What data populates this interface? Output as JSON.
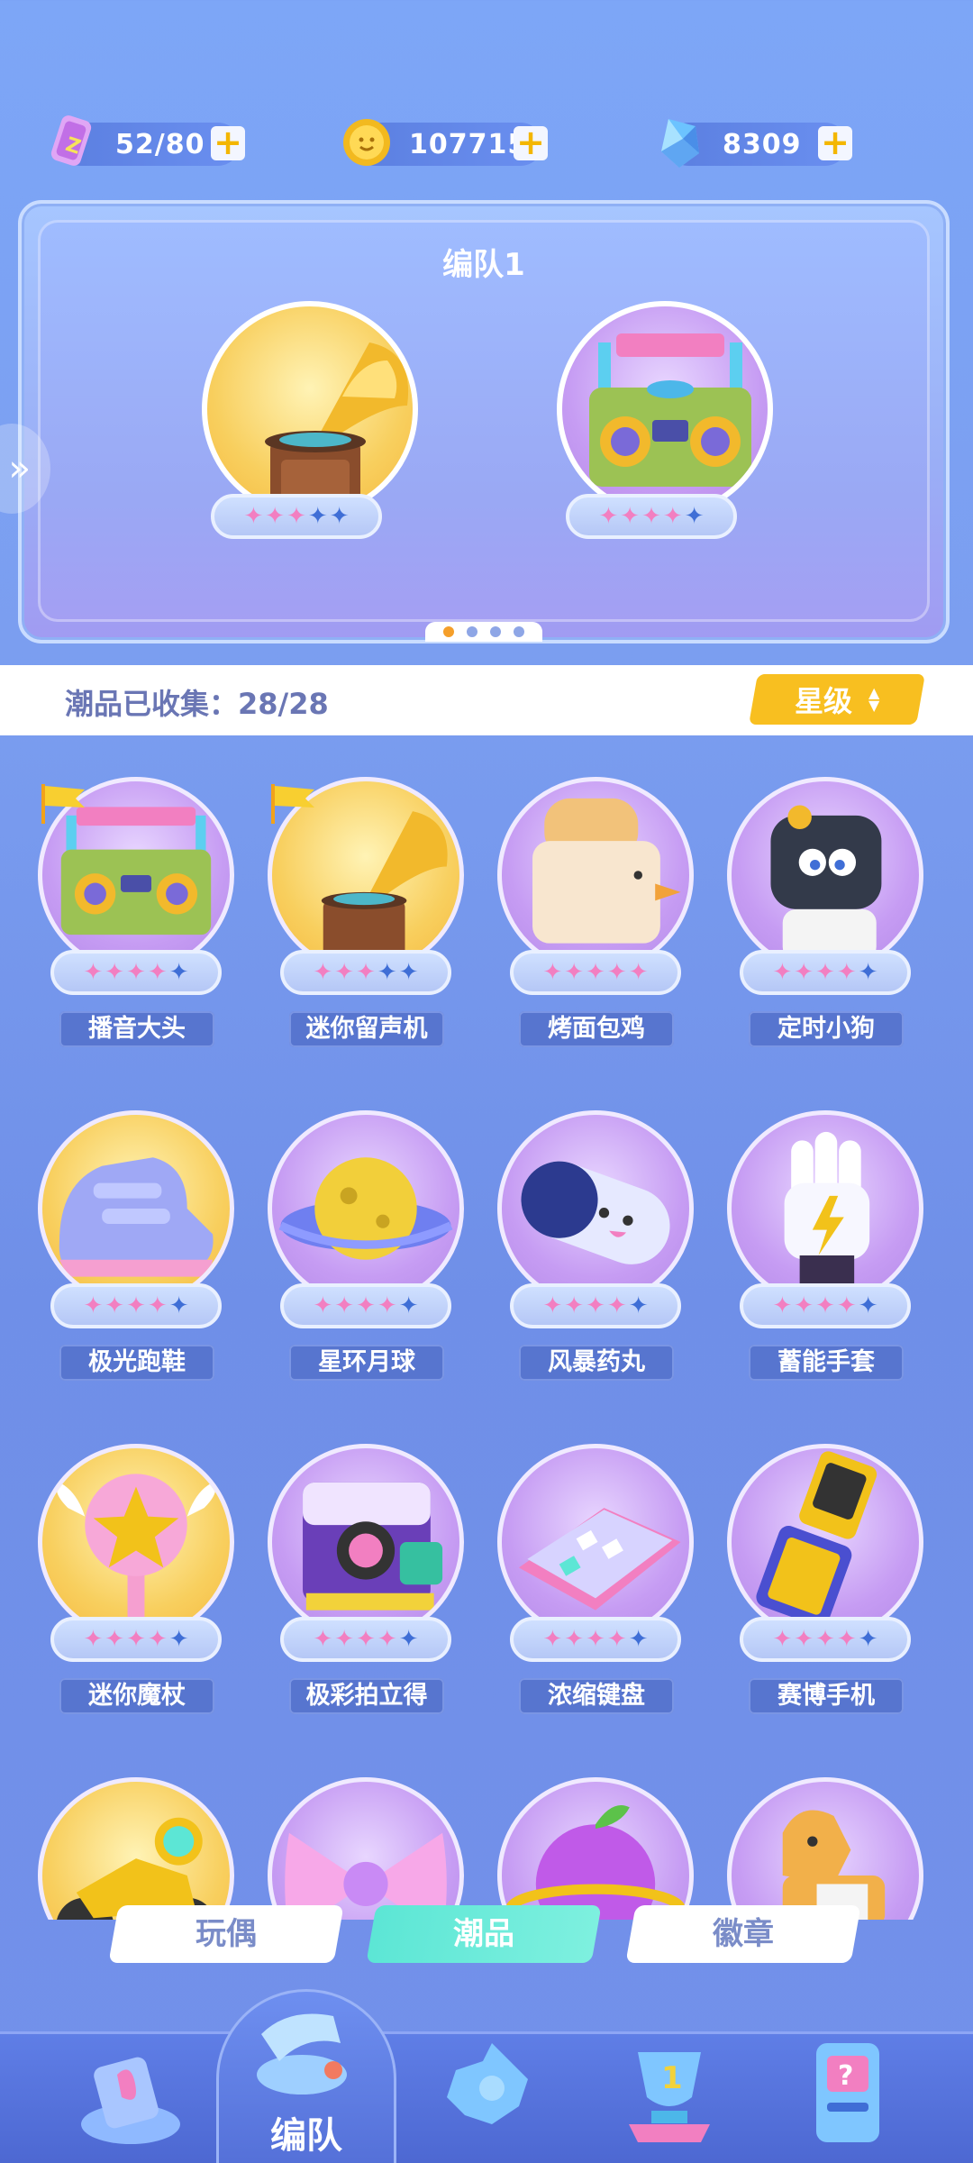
{
  "currency": {
    "energy": {
      "value": "52/80",
      "icon": "energy-ticket-icon"
    },
    "coins": {
      "value": "107715",
      "icon": "gold-coin-icon"
    },
    "gems": {
      "value": "8309",
      "icon": "crystal-gem-icon"
    },
    "plus_symbol": "+"
  },
  "team": {
    "title": "编队1",
    "slots": [
      {
        "icon": "gramophone-icon",
        "stars_pink": 3,
        "stars_blue": 2
      },
      {
        "icon": "boombox-icon",
        "stars_pink": 4,
        "stars_blue": 1
      }
    ],
    "pages": 4,
    "current_page": 1
  },
  "collection": {
    "label": "潮品已收集：28/28",
    "sort_label": "星级"
  },
  "items": [
    {
      "name": "播音大头",
      "icon": "boombox-icon",
      "stars_pink": 4,
      "stars_blue": 1,
      "flag": true,
      "bg": "purple"
    },
    {
      "name": "迷你留声机",
      "icon": "gramophone-icon",
      "stars_pink": 3,
      "stars_blue": 2,
      "flag": true,
      "bg": "gold"
    },
    {
      "name": "烤面包鸡",
      "icon": "toaster-chicken-icon",
      "stars_pink": 5,
      "stars_blue": 0,
      "flag": false,
      "bg": "purple"
    },
    {
      "name": "定时小狗",
      "icon": "timer-dog-icon",
      "stars_pink": 4,
      "stars_blue": 1,
      "flag": false,
      "bg": "purple"
    },
    {
      "name": "极光跑鞋",
      "icon": "sneaker-icon",
      "stars_pink": 4,
      "stars_blue": 1,
      "flag": false,
      "bg": "gold"
    },
    {
      "name": "星环月球",
      "icon": "ringed-moon-icon",
      "stars_pink": 4,
      "stars_blue": 1,
      "flag": false,
      "bg": "purple"
    },
    {
      "name": "风暴药丸",
      "icon": "storm-pill-icon",
      "stars_pink": 4,
      "stars_blue": 1,
      "flag": false,
      "bg": "purple"
    },
    {
      "name": "蓄能手套",
      "icon": "power-glove-icon",
      "stars_pink": 4,
      "stars_blue": 1,
      "flag": false,
      "bg": "purple"
    },
    {
      "name": "迷你魔杖",
      "icon": "magic-wand-icon",
      "stars_pink": 4,
      "stars_blue": 1,
      "flag": false,
      "bg": "gold"
    },
    {
      "name": "极彩拍立得",
      "icon": "instant-camera-icon",
      "stars_pink": 4,
      "stars_blue": 1,
      "flag": false,
      "bg": "purple"
    },
    {
      "name": "浓缩键盘",
      "icon": "mini-keyboard-icon",
      "stars_pink": 4,
      "stars_blue": 1,
      "flag": false,
      "bg": "purple"
    },
    {
      "name": "赛博手机",
      "icon": "flip-phone-icon",
      "stars_pink": 4,
      "stars_blue": 1,
      "flag": false,
      "bg": "purple"
    },
    {
      "name": "",
      "icon": "motorbike-icon",
      "stars_pink": 0,
      "stars_blue": 0,
      "flag": false,
      "bg": "gold"
    },
    {
      "name": "",
      "icon": "candy-bow-icon",
      "stars_pink": 0,
      "stars_blue": 0,
      "flag": false,
      "bg": "purple"
    },
    {
      "name": "",
      "icon": "plum-planet-icon",
      "stars_pink": 0,
      "stars_blue": 0,
      "flag": false,
      "bg": "purple"
    },
    {
      "name": "",
      "icon": "rocking-horse-icon",
      "stars_pink": 0,
      "stars_blue": 0,
      "flag": false,
      "bg": "purple"
    }
  ],
  "subtabs": [
    {
      "label": "玩偶",
      "active": false
    },
    {
      "label": "潮品",
      "active": true
    },
    {
      "label": "徽章",
      "active": false
    }
  ],
  "nav": {
    "items": [
      "ticket-icon",
      "whistle-icon",
      "puzzle-icon",
      "trophy-icon",
      "mystery-machine-icon"
    ],
    "active_label": "编队"
  },
  "colors": {
    "bg": "#7b9ef0",
    "accent_yellow": "#f8bf20",
    "active_tab": "#5ce6d5",
    "name_plate": "#5775cf",
    "star_pink": "#f27fc1",
    "star_blue": "#3f6ed6"
  }
}
